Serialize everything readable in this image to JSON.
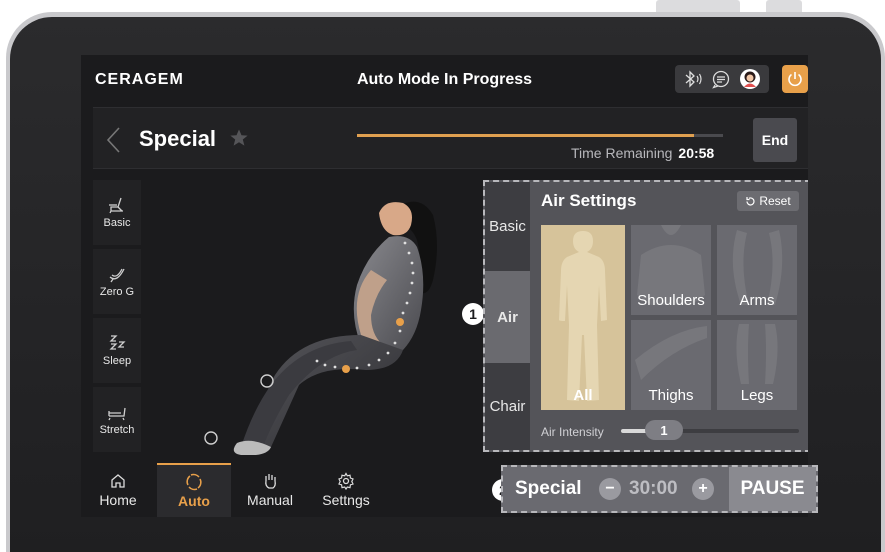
{
  "header": {
    "logo": "CERAGEM",
    "title": "Auto Mode In Progress",
    "icons": [
      "bluetooth-audio-icon",
      "message-icon",
      "user-avatar-icon",
      "power-icon"
    ]
  },
  "program": {
    "name": "Special",
    "progress_fraction": 0.92,
    "time_remaining_label": "Time Remaining",
    "time_remaining_value": "20:58",
    "end_label": "End"
  },
  "modes": [
    {
      "label": "Basic",
      "icon": "recliner-basic-icon"
    },
    {
      "label": "Zero G",
      "icon": "zero-g-icon"
    },
    {
      "label": "Sleep",
      "icon": "sleep-zz-icon"
    },
    {
      "label": "Stretch",
      "icon": "stretch-icon"
    }
  ],
  "air_settings": {
    "title": "Air Settings",
    "reset_label": "Reset",
    "tabs": [
      "Basic",
      "Air",
      "Chair"
    ],
    "active_tab": "Air",
    "zones": [
      "All",
      "Shoulders",
      "Arms",
      "Thighs",
      "Legs"
    ],
    "selected_zone": "All",
    "intensity_label": "Air Intensity",
    "intensity_value": "1",
    "intensity_fraction": 0.2
  },
  "callouts": {
    "one": "1",
    "two": "2"
  },
  "nav": {
    "items": [
      "Home",
      "Auto",
      "Manual",
      "Settngs"
    ],
    "active": "Auto"
  },
  "control": {
    "program_label": "Special",
    "minus": "−",
    "duration": "30:00",
    "plus": "+",
    "pause_label": "PAUSE"
  },
  "colors": {
    "accent": "#e8a04a",
    "selected_zone": "#d6c39a",
    "screen_bg": "#1b1b1d"
  }
}
